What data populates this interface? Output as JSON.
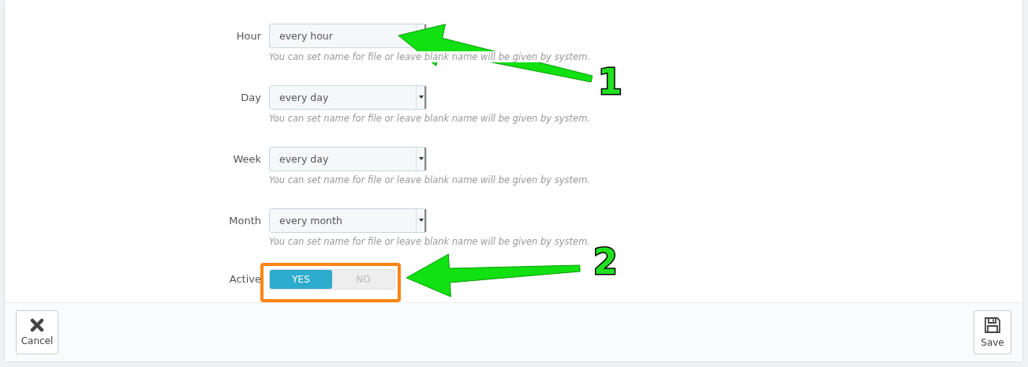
{
  "fields": [
    {
      "label": "Hour",
      "value": "every hour",
      "help": "You can set name for file or leave blank name will be given by system."
    },
    {
      "label": "Day",
      "value": "every day",
      "help": "You can set name for file or leave blank name will be given by system."
    },
    {
      "label": "Week",
      "value": "every day",
      "help": "You can set name for file or leave blank name will be given by system."
    },
    {
      "label": "Month",
      "value": "every month",
      "help": "You can set name for file or leave blank name will be given by system."
    }
  ],
  "active": {
    "label": "Active",
    "options": [
      {
        "label": "YES",
        "selected": true
      },
      {
        "label": "NO",
        "selected": false
      }
    ]
  },
  "footer": {
    "buttons": [
      {
        "label": "Cancel",
        "kind": "cancel"
      },
      {
        "label": "Save",
        "kind": "save"
      }
    ]
  },
  "callouts": [
    {
      "number": "1",
      "highlight": false
    },
    {
      "number": "2",
      "highlight": true
    }
  ]
}
